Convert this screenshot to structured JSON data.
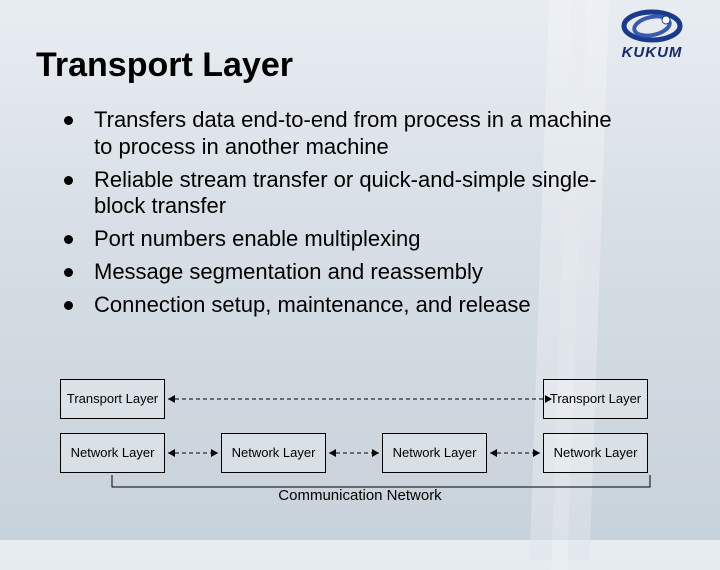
{
  "logo": {
    "text": "KUKUM"
  },
  "title": "Transport Layer",
  "bullets": [
    "Transfers data end-to-end from process in a machine to process in another machine",
    "Reliable stream transfer or quick-and-simple single-block transfer",
    "Port numbers enable multiplexing",
    "Message segmentation and reassembly",
    "Connection setup, maintenance, and release"
  ],
  "diagram": {
    "transport_label": "Transport Layer",
    "network_label": "Network Layer",
    "caption": "Communication Network"
  }
}
